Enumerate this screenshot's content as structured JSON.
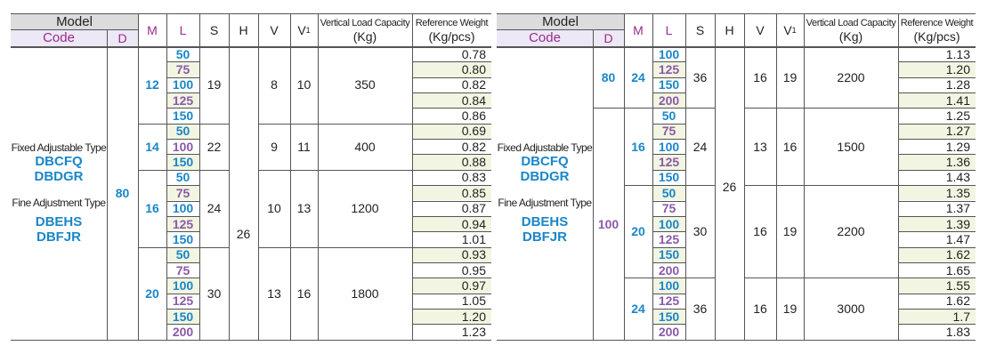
{
  "headers": {
    "model": "Model",
    "code": "Code",
    "d": "D",
    "m": "M",
    "l": "L",
    "s": "S",
    "h": "H",
    "v": "V",
    "v1_base": "V",
    "v1_sub": "1",
    "load_line1": "Vertical Load Capacity",
    "load_line2": "(Kg)",
    "weight_line1": "Reference Weight",
    "weight_line2": "(Kg/pcs)"
  },
  "types": {
    "fixed_label": "Fixed Adjustable Type",
    "fixed_codes": [
      "DBCFQ",
      "DBDGR"
    ],
    "fine_label": "Fine Adjustment Type",
    "fine_codes": [
      "DBEHS",
      "DBFJR"
    ]
  },
  "left_table": {
    "d": "80",
    "h": "26",
    "groups": [
      {
        "m": "12",
        "s": "19",
        "v": "8",
        "v1": "10",
        "load": "350",
        "rows": [
          [
            "50",
            "0.78"
          ],
          [
            "75",
            "0.80"
          ],
          [
            "100",
            "0.82"
          ],
          [
            "125",
            "0.84"
          ],
          [
            "150",
            "0.86"
          ]
        ]
      },
      {
        "m": "14",
        "s": "22",
        "v": "9",
        "v1": "11",
        "load": "400",
        "rows": [
          [
            "50",
            "0.69"
          ],
          [
            "100",
            "0.82"
          ],
          [
            "150",
            "0.88"
          ]
        ]
      },
      {
        "m": "16",
        "s": "24",
        "v": "10",
        "v1": "13",
        "load": "1200",
        "rows": [
          [
            "50",
            "0.83"
          ],
          [
            "75",
            "0.85"
          ],
          [
            "100",
            "0.87"
          ],
          [
            "125",
            "0.94"
          ],
          [
            "150",
            "1.01"
          ]
        ]
      },
      {
        "m": "20",
        "s": "30",
        "v": "13",
        "v1": "16",
        "load": "1800",
        "rows": [
          [
            "50",
            "0.93"
          ],
          [
            "75",
            "0.95"
          ],
          [
            "100",
            "0.97"
          ],
          [
            "125",
            "1.05"
          ],
          [
            "150",
            "1.20"
          ],
          [
            "200",
            "1.23"
          ]
        ]
      }
    ]
  },
  "right_table": {
    "h": "26",
    "d_blocks": [
      {
        "d": "80",
        "groups": [
          {
            "m": "24",
            "s": "36",
            "v": "16",
            "v1": "19",
            "load": "2200",
            "rows": [
              [
                "100",
                "1.13"
              ],
              [
                "125",
                "1.20"
              ],
              [
                "150",
                "1.28"
              ],
              [
                "200",
                "1.41"
              ]
            ]
          }
        ]
      },
      {
        "d": "100",
        "groups": [
          {
            "m": "16",
            "s": "24",
            "v": "13",
            "v1": "16",
            "load": "1500",
            "rows": [
              [
                "50",
                "1.25"
              ],
              [
                "75",
                "1.27"
              ],
              [
                "100",
                "1.29"
              ],
              [
                "125",
                "1.36"
              ],
              [
                "150",
                "1.43"
              ]
            ]
          },
          {
            "m": "20",
            "s": "30",
            "v": "16",
            "v1": "19",
            "load": "2200",
            "rows": [
              [
                "50",
                "1.35"
              ],
              [
                "75",
                "1.37"
              ],
              [
                "100",
                "1.39"
              ],
              [
                "125",
                "1.47"
              ],
              [
                "150",
                "1.62"
              ],
              [
                "200",
                "1.65"
              ]
            ]
          },
          {
            "m": "24",
            "s": "36",
            "v": "16",
            "v1": "19",
            "load": "3000",
            "rows": [
              [
                "100",
                "1.55"
              ],
              [
                "125",
                "1.62"
              ],
              [
                "150",
                "1.7"
              ],
              [
                "200",
                "1.83"
              ]
            ]
          }
        ]
      }
    ]
  },
  "colors": {
    "header_gray": "#dcdcdc",
    "header_lavender": "#ece8f5",
    "band_yellow": "#f2f5e1",
    "code_pink": "#9c2a8c",
    "blue": "#1a86c8",
    "purple": "#8a5aa8"
  }
}
